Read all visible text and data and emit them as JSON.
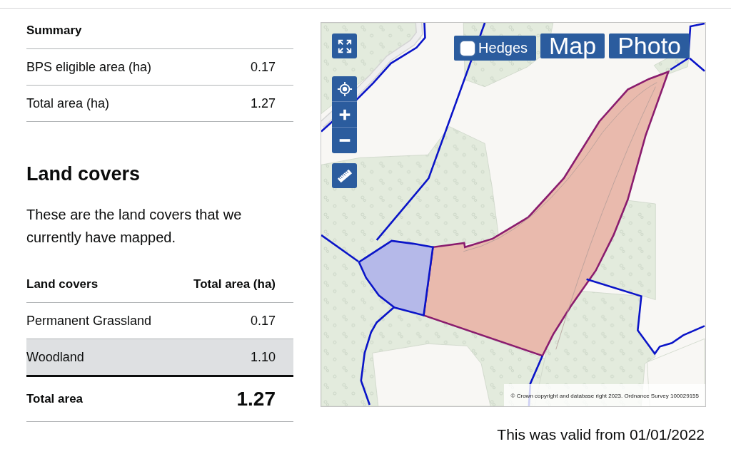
{
  "summary": {
    "heading": "Summary",
    "rows": [
      {
        "label": "BPS eligible area (ha)",
        "value": "0.17"
      },
      {
        "label": "Total area (ha)",
        "value": "1.27"
      }
    ]
  },
  "land_covers": {
    "heading": "Land covers",
    "intro": "These are the land covers that we currently have mapped.",
    "table": {
      "columns": [
        "Land covers",
        "Total area (ha)"
      ],
      "rows": [
        {
          "name": "Permanent Grassland",
          "area": "0.17",
          "selected": false
        },
        {
          "name": "Woodland",
          "area": "1.10",
          "selected": true
        }
      ],
      "total": {
        "label": "Total area",
        "value": "1.27"
      }
    }
  },
  "map": {
    "hedges": {
      "label": "Hedges",
      "checked": false
    },
    "layer_buttons": [
      "Map",
      "Photo"
    ],
    "copyright": "© Crown copyright and database right 2023. Ordnance Survey 100029155"
  },
  "validity": "This was valid from 01/01/2022"
}
